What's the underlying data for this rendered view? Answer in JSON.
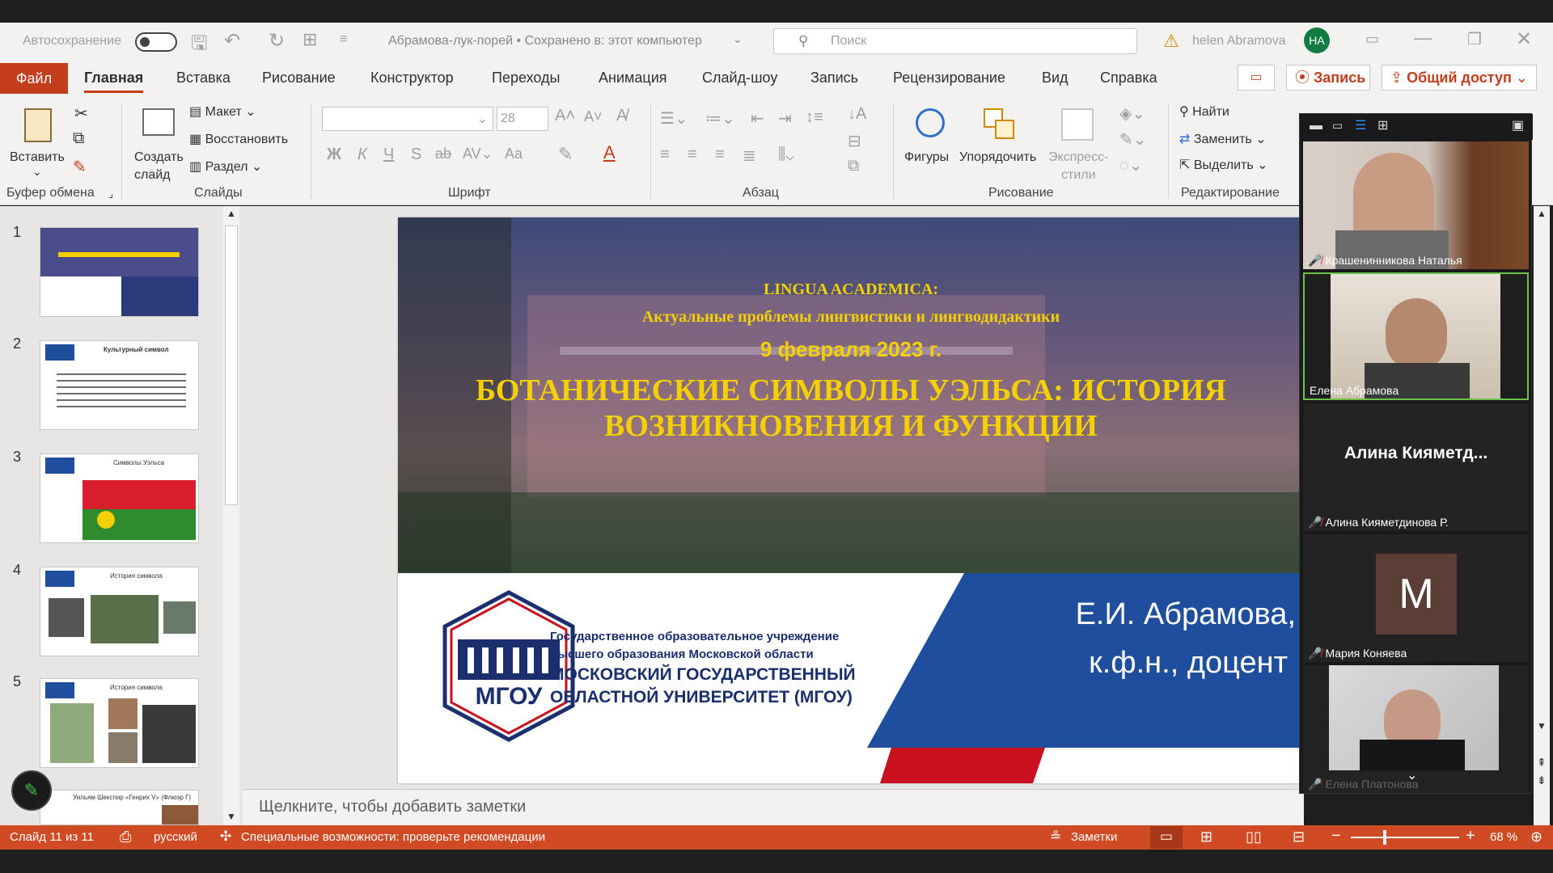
{
  "titlebar": {
    "autosave_label": "Автосохранение",
    "doc_title": "Абрамова-лук-порей • Сохранено в: этот компьютер",
    "search_placeholder": "Поиск",
    "user_name": "helen Abramova",
    "user_initials": "НА"
  },
  "tabs": [
    "Файл",
    "Главная",
    "Вставка",
    "Рисование",
    "Конструктор",
    "Переходы",
    "Анимация",
    "Слайд-шоу",
    "Запись",
    "Рецензирование",
    "Вид",
    "Справка"
  ],
  "tab_actions": {
    "record": "Запись",
    "share": "Общий доступ"
  },
  "ribbon": {
    "paste": "Вставить",
    "clipboard_group": "Буфер обмена",
    "new_slide_line1": "Создать",
    "new_slide_line2": "слайд",
    "layout": "Макет",
    "reset": "Восстановить",
    "section": "Раздел",
    "slides_group": "Слайды",
    "font_size": "28",
    "font_group": "Шрифт",
    "paragraph_group": "Абзац",
    "shapes": "Фигуры",
    "arrange": "Упорядочить",
    "quick_styles_line1": "Экспресс-",
    "quick_styles_line2": "стили",
    "drawing_group": "Рисование",
    "find": "Найти",
    "replace": "Заменить",
    "select": "Выделить",
    "editing_group": "Редактирование",
    "bold": "Ж",
    "italic": "К",
    "underline": "Ч",
    "strike": "S",
    "case": "Aa"
  },
  "thumbnails": {
    "numbers": [
      "1",
      "2",
      "3",
      "4",
      "5"
    ],
    "t2_title": "Культурный символ",
    "t3_title": "Символы Уэльса",
    "t4_title": "История символа",
    "t5_title": "История символа",
    "t6_title": "Уильям Шекспир «Генрих V» (Флюэр Г)"
  },
  "slide": {
    "conf_line1": "LINGUA ACADEMICA:",
    "conf_line2": "Актуальные проблемы лингвистики и лингводидактики",
    "date": "9 февраля 2023 г.",
    "title_line1": "БОТАНИЧЕСКИЕ СИМВОЛЫ УЭЛЬСА: ИСТОРИЯ",
    "title_line2": "ВОЗНИКНОВЕНИЯ И ФУНКЦИИ",
    "org_line1": "Государственное образовательное учреждение",
    "org_line2": "высшего образования Московской области",
    "org_line3": "МОСКОВСКИЙ ГОСУДАРСТВЕННЫЙ",
    "org_line4": "ОБЛАСТНОЙ УНИВЕРСИТЕТ (МГОУ)",
    "logo_text": "МГОУ",
    "author_line1": "Е.И. Абрамова,",
    "author_line2": "к.ф.н., доцент"
  },
  "notes_placeholder": "Щелкните, чтобы добавить заметки",
  "status": {
    "slide_info": "Слайд 11 из 11",
    "language": "русский",
    "accessibility": "Специальные возможности: проверьте рекомендации",
    "notes": "Заметки",
    "zoom": "68 %"
  },
  "zoom_participants": {
    "p1": "Крашенинникова Наталья",
    "p2": "Елена Абрамова",
    "p3_big": "Алина Кияметд...",
    "p3": "Алина Кияметдинова Р.",
    "p4_initial": "M",
    "p4": "Мария Коняева",
    "p5": "Елена Платонова"
  },
  "colors": {
    "accent": "#c43e1c",
    "statusbar": "#d04a23",
    "slide_blue": "#1f4e9c",
    "slide_yellow": "#f5d000",
    "logo_navy": "#1b2f6e"
  }
}
